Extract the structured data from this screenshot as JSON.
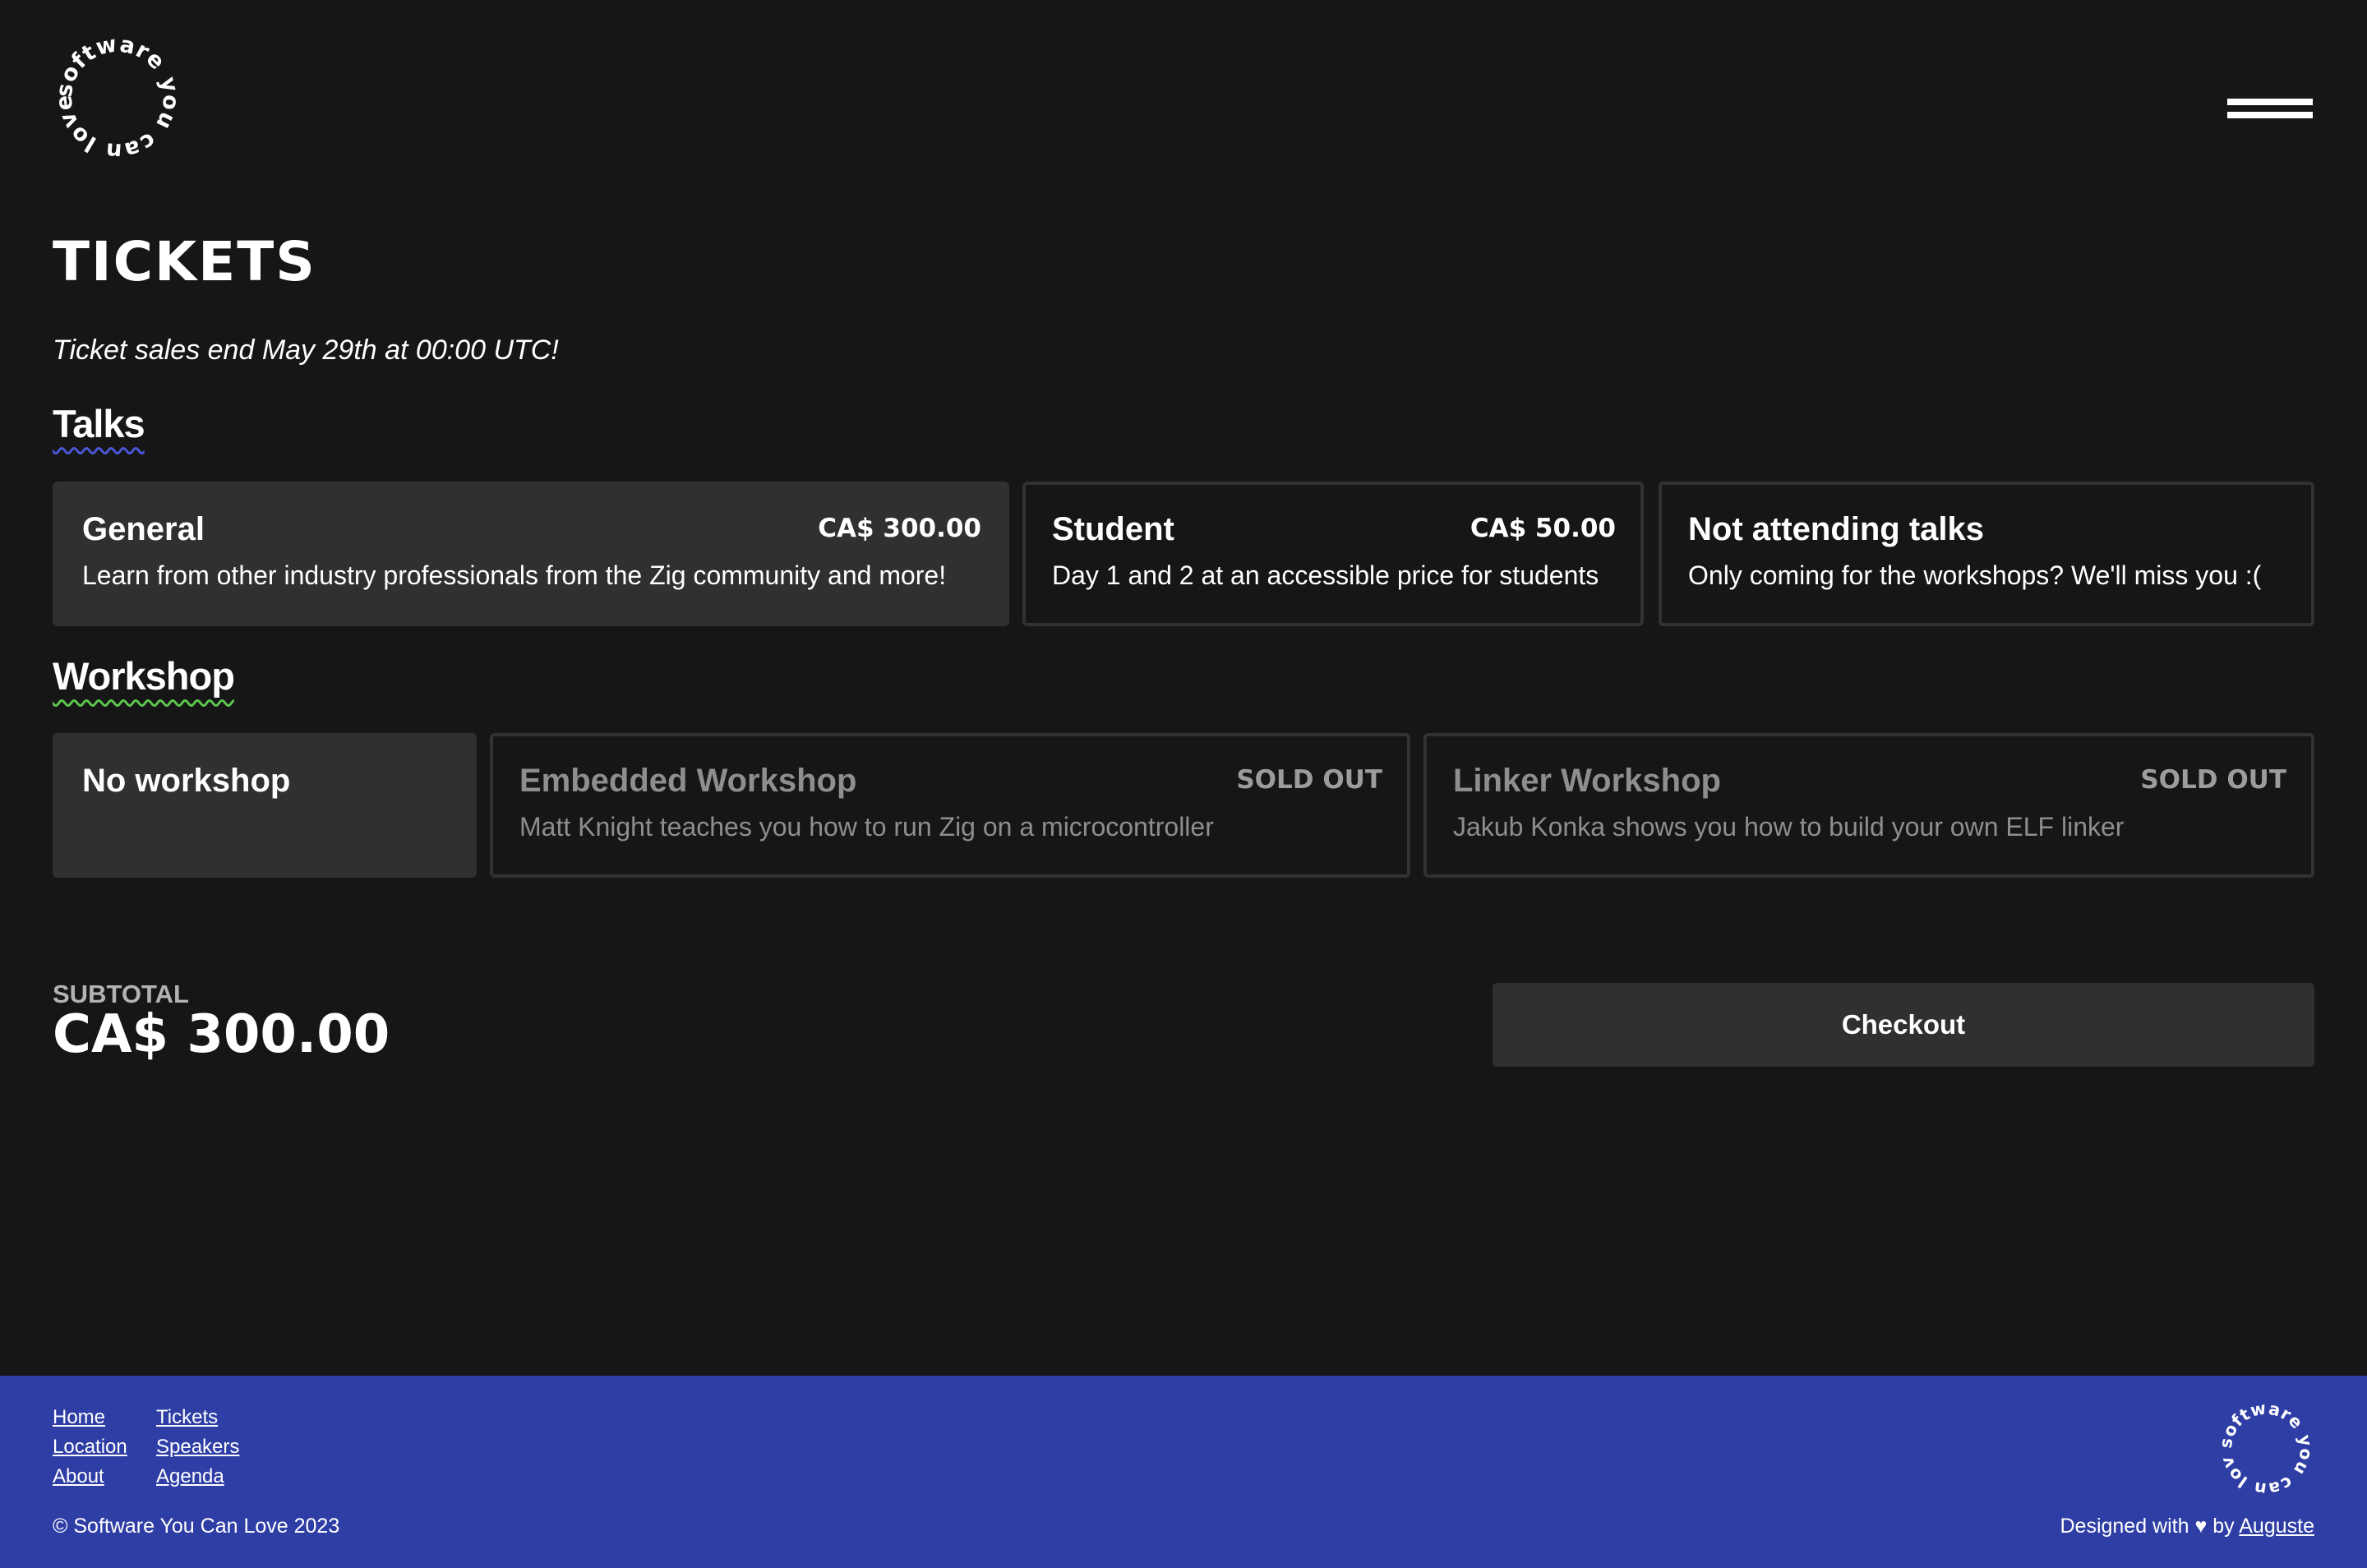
{
  "logo": {
    "text": "software you can love",
    "icon": "circular-text-logo"
  },
  "menu": {
    "icon": "hamburger-menu-icon"
  },
  "page": {
    "title": "TICKETS",
    "notice": "Ticket sales end May 29th at 00:00 UTC!"
  },
  "talks": {
    "title": "Talks",
    "underline_color": "#4b57d6",
    "options": [
      {
        "name": "General",
        "price": "CA$ 300.00",
        "description": "Learn from other industry professionals from the Zig community and more!",
        "selected": true
      },
      {
        "name": "Student",
        "price": "CA$ 50.00",
        "description": "Day 1 and 2 at an accessible price for students",
        "selected": false
      },
      {
        "name": "Not attending talks",
        "price": "",
        "description": "Only coming for the workshops? We'll miss you :(",
        "selected": false
      }
    ]
  },
  "workshop": {
    "title": "Workshop",
    "underline_color": "#5cc54d",
    "options": [
      {
        "name": "No workshop",
        "price": "",
        "description": "",
        "selected": true
      },
      {
        "name": "Embedded Workshop",
        "price": "SOLD OUT",
        "description": "Matt Knight teaches you how to run Zig on a microcontroller",
        "disabled": true
      },
      {
        "name": "Linker Workshop",
        "price": "SOLD OUT",
        "description": "Jakub Konka shows you how to build your own ELF linker",
        "disabled": true
      }
    ]
  },
  "summary": {
    "subtotal_label": "SUBTOTAL",
    "subtotal_value": "CA$ 300.00",
    "checkout_label": "Checkout"
  },
  "footer": {
    "background": "#2f3ea5",
    "links": {
      "home": "Home",
      "location": "Location",
      "about": "About",
      "tickets": "Tickets",
      "speakers": "Speakers",
      "agenda": "Agenda"
    },
    "copyright": "© Software You Can Love 2023",
    "credit_prefix": "Designed with",
    "heart_icon": "♥",
    "credit_by": "by",
    "credit_name": "Auguste"
  },
  "colors": {
    "background": "#161616",
    "card_selected": "#303030",
    "card_border": "#323232",
    "text": "#ffffff",
    "muted": "#8e8e8e"
  }
}
